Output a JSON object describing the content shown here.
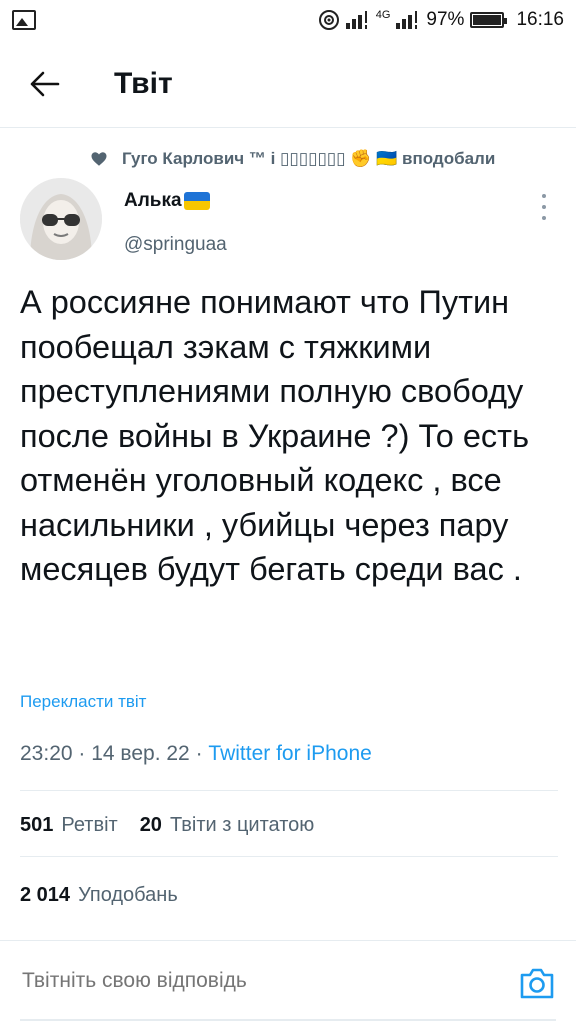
{
  "status_bar": {
    "network": "4G",
    "battery": "97%",
    "battery_level": 0.97,
    "time": "16:16"
  },
  "header": {
    "title": "Твіт"
  },
  "liked_by": {
    "text": "Гуго Карлович ™ і ▯▯▯▯▯▯▯ ✊ 🇺🇦 вподобали"
  },
  "tweet": {
    "author_name": "Алька",
    "author_handle": "@springuaa",
    "text": "А россияне понимают что Путин пообещал зэкам с тяжкими преступлениями полную свободу после войны в Украине ?) То есть отменён уголовный кодекс , все насильники , убийцы через пару месяцев будут бегать среди вас .",
    "translate_label": "Перекласти твіт",
    "time": "23:20",
    "date": "14 вер. 22",
    "source": "Twitter for iPhone",
    "sep": " · "
  },
  "stats": {
    "retweets_count": "501",
    "retweets_label": "Ретвіт",
    "quotes_count": "20",
    "quotes_label": "Твіти з цитатою",
    "likes_count": "2 014",
    "likes_label": "Уподобань"
  },
  "reply": {
    "placeholder": "Твітніть свою відповідь"
  },
  "colors": {
    "accent": "#1d9bf0",
    "secondary_text": "#536471",
    "flag_blue": "#1e73d6",
    "flag_yellow": "#f7c600"
  },
  "icons": [
    "gallery-icon",
    "wifi-icon",
    "signal-icon",
    "battery-icon",
    "back-arrow-icon",
    "heart-icon",
    "more-icon",
    "camera-icon"
  ]
}
